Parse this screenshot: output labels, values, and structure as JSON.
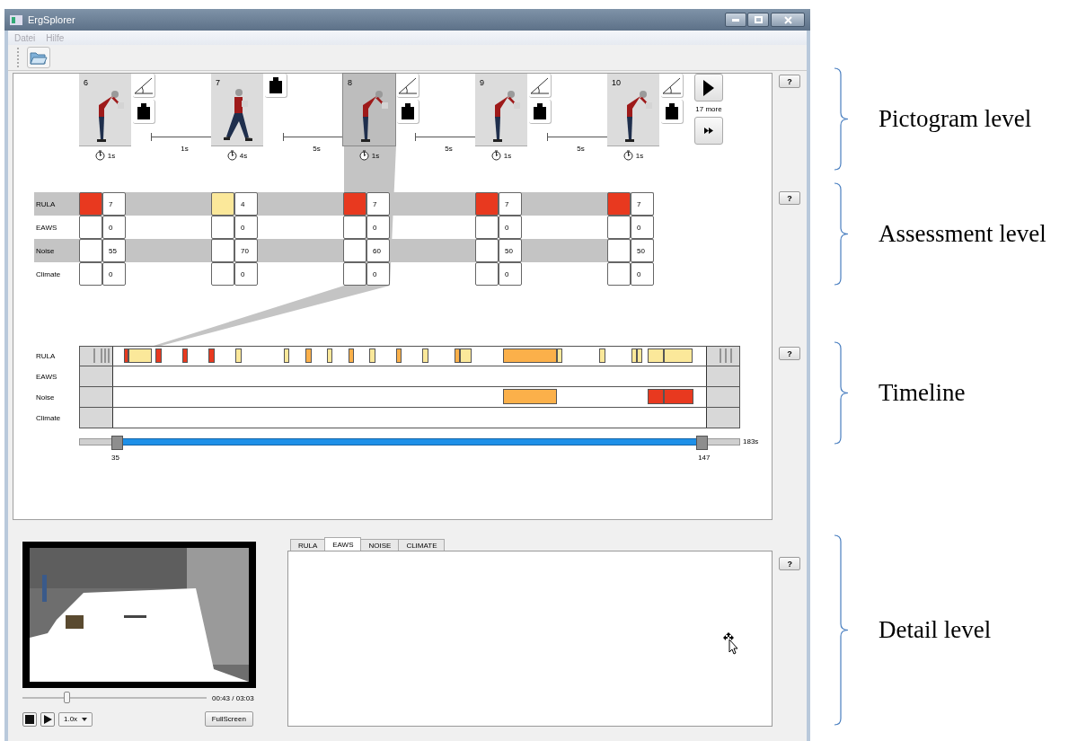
{
  "window": {
    "title": "ErgSplorer"
  },
  "menu": [
    {
      "label": "Datei"
    },
    {
      "label": "Hilfe"
    }
  ],
  "pictograms": [
    {
      "number": "6",
      "kind": "bending",
      "duration": "1s",
      "selected": false,
      "badges": [
        {
          "kind": "angle"
        },
        {
          "kind": "weight"
        }
      ],
      "gap": "1s"
    },
    {
      "number": "7",
      "kind": "walking",
      "duration": "4s",
      "selected": false,
      "badges": [
        {
          "kind": "weight"
        }
      ],
      "gap": "5s"
    },
    {
      "number": "8",
      "kind": "bending",
      "duration": "1s",
      "selected": true,
      "badges": [
        {
          "kind": "angle"
        },
        {
          "kind": "weight"
        }
      ],
      "gap": "5s"
    },
    {
      "number": "9",
      "kind": "bending",
      "duration": "1s",
      "selected": false,
      "badges": [
        {
          "kind": "angle"
        },
        {
          "kind": "weight"
        }
      ],
      "gap": "5s"
    },
    {
      "number": "10",
      "kind": "bending",
      "duration": "1s",
      "selected": false,
      "badges": [
        {
          "kind": "angle"
        },
        {
          "kind": "weight"
        }
      ]
    }
  ],
  "pictogram_nav": {
    "more": "17 more"
  },
  "assessment": {
    "labels": [
      "RULA",
      "EAWS",
      "Noise",
      "Climate"
    ],
    "columns": [
      {
        "cells": [
          {
            "color": "#e8391f",
            "value": "7"
          },
          {
            "color": "#ffffff",
            "value": "0"
          },
          {
            "color": "#ffffff",
            "value": "55"
          },
          {
            "color": "#ffffff",
            "value": "0"
          }
        ]
      },
      {
        "cells": [
          {
            "color": "#fbe89a",
            "value": "4"
          },
          {
            "color": "#ffffff",
            "value": "0"
          },
          {
            "color": "#ffffff",
            "value": "70"
          },
          {
            "color": "#ffffff",
            "value": "0"
          }
        ]
      },
      {
        "cells": [
          {
            "color": "#e8391f",
            "value": "7"
          },
          {
            "color": "#ffffff",
            "value": "0"
          },
          {
            "color": "#ffffff",
            "value": "60"
          },
          {
            "color": "#ffffff",
            "value": "0"
          }
        ]
      },
      {
        "cells": [
          {
            "color": "#e8391f",
            "value": "7"
          },
          {
            "color": "#ffffff",
            "value": "0"
          },
          {
            "color": "#ffffff",
            "value": "50"
          },
          {
            "color": "#ffffff",
            "value": "0"
          }
        ]
      },
      {
        "cells": [
          {
            "color": "#e8391f",
            "value": "7"
          },
          {
            "color": "#ffffff",
            "value": "0"
          },
          {
            "color": "#ffffff",
            "value": "50"
          },
          {
            "color": "#ffffff",
            "value": "0"
          }
        ]
      }
    ]
  },
  "timeline": {
    "rows": [
      {
        "label": "RULA"
      },
      {
        "label": "EAWS"
      },
      {
        "label": "Noise"
      },
      {
        "label": "Climate"
      }
    ],
    "range": {
      "start": {
        "label": "35",
        "level": 0.056
      },
      "end": {
        "label": "147",
        "level": 0.943
      },
      "total": "183s"
    }
  },
  "help_buttons": [
    "?",
    "?",
    "?",
    "?"
  ],
  "player": {
    "level": 0.24,
    "time": "00:43 / 03:03",
    "speed": "1.0x",
    "fullscreen": "FullScreen"
  },
  "detail_tabs": [
    {
      "label": "RULA",
      "selected": false
    },
    {
      "label": "EAWS",
      "selected": true
    },
    {
      "label": "NOISE",
      "selected": false
    },
    {
      "label": "CLIMATE",
      "selected": false
    }
  ],
  "annotations": [
    {
      "label": "Pictogram level"
    },
    {
      "label": "Assessment level"
    },
    {
      "label": "Timeline"
    },
    {
      "label": "Detail level"
    }
  ]
}
